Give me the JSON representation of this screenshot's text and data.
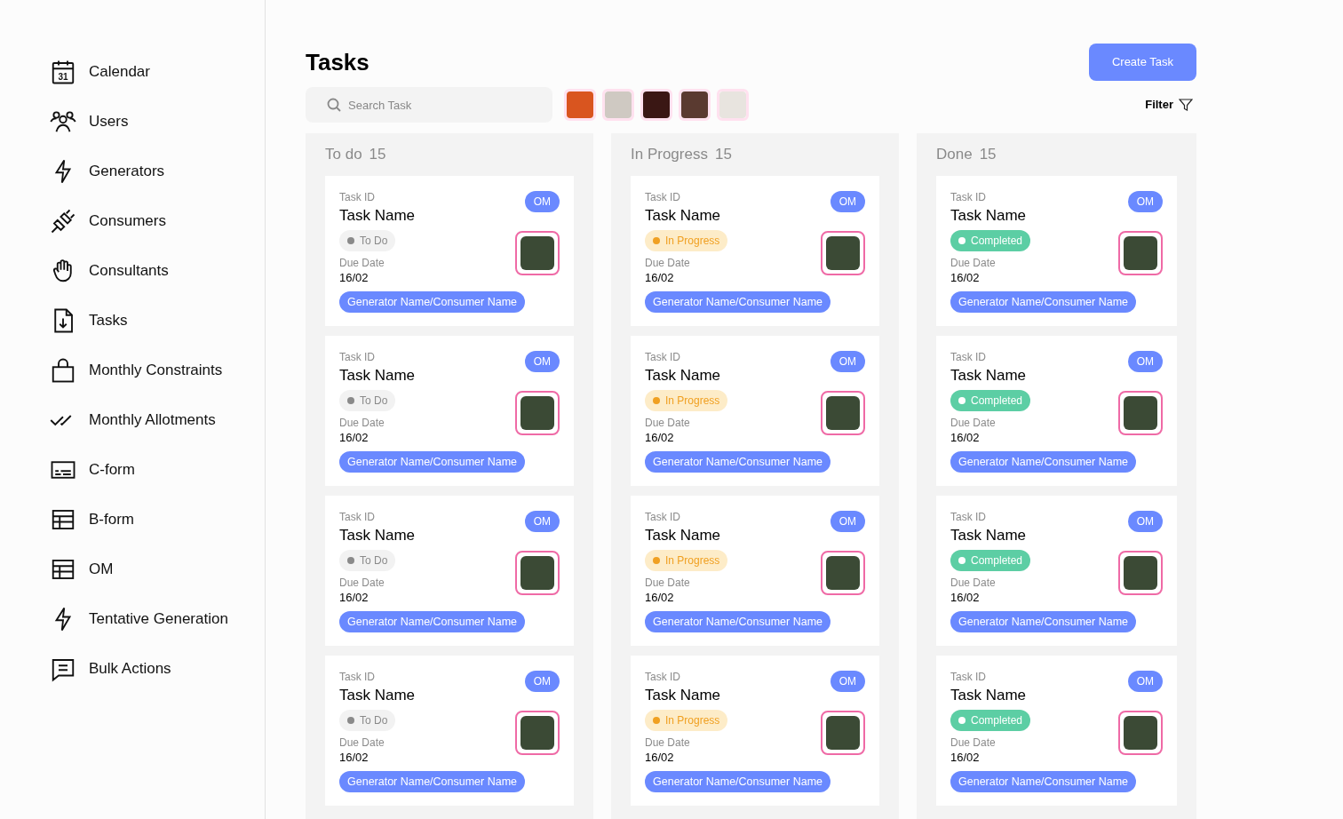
{
  "sidebar": {
    "items": [
      {
        "label": "Calendar",
        "icon_day": "31"
      },
      {
        "label": "Users"
      },
      {
        "label": "Generators"
      },
      {
        "label": "Consumers"
      },
      {
        "label": "Consultants"
      },
      {
        "label": "Tasks"
      },
      {
        "label": "Monthly Constraints"
      },
      {
        "label": "Monthly Allotments"
      },
      {
        "label": "C-form"
      },
      {
        "label": "B-form"
      },
      {
        "label": "OM"
      },
      {
        "label": "Tentative Generation"
      },
      {
        "label": "Bulk Actions"
      }
    ]
  },
  "header": {
    "title": "Tasks",
    "create_button": "Create Task",
    "search": {
      "placeholder": "Search Task"
    },
    "filter": "Filter"
  },
  "board": {
    "columns": [
      {
        "title": "To do",
        "count": "15",
        "cards": [
          {
            "id": "Task ID",
            "name": "Task Name",
            "badge": "OM",
            "status": {
              "kind": "todo",
              "label": "To Do"
            },
            "due_label": "Due Date",
            "due": "16/02",
            "tag": "Generator Name/Consumer Name"
          },
          {
            "id": "Task ID",
            "name": "Task Name",
            "badge": "OM",
            "status": {
              "kind": "todo",
              "label": "To Do"
            },
            "due_label": "Due Date",
            "due": "16/02",
            "tag": "Generator Name/Consumer Name"
          },
          {
            "id": "Task ID",
            "name": "Task Name",
            "badge": "OM",
            "status": {
              "kind": "todo",
              "label": "To Do"
            },
            "due_label": "Due Date",
            "due": "16/02",
            "tag": "Generator Name/Consumer Name"
          },
          {
            "id": "Task ID",
            "name": "Task Name",
            "badge": "OM",
            "status": {
              "kind": "todo",
              "label": "To Do"
            },
            "due_label": "Due Date",
            "due": "16/02",
            "tag": "Generator Name/Consumer Name"
          }
        ]
      },
      {
        "title": "In Progress",
        "count": "15",
        "cards": [
          {
            "id": "Task ID",
            "name": "Task Name",
            "badge": "OM",
            "status": {
              "kind": "progress",
              "label": "In Progress"
            },
            "due_label": "Due Date",
            "due": "16/02",
            "tag": "Generator Name/Consumer Name"
          },
          {
            "id": "Task ID",
            "name": "Task Name",
            "badge": "OM",
            "status": {
              "kind": "progress",
              "label": "In Progress"
            },
            "due_label": "Due Date",
            "due": "16/02",
            "tag": "Generator Name/Consumer Name"
          },
          {
            "id": "Task ID",
            "name": "Task Name",
            "badge": "OM",
            "status": {
              "kind": "progress",
              "label": "In Progress"
            },
            "due_label": "Due Date",
            "due": "16/02",
            "tag": "Generator Name/Consumer Name"
          },
          {
            "id": "Task ID",
            "name": "Task Name",
            "badge": "OM",
            "status": {
              "kind": "progress",
              "label": "In Progress"
            },
            "due_label": "Due Date",
            "due": "16/02",
            "tag": "Generator Name/Consumer Name"
          }
        ]
      },
      {
        "title": "Done",
        "count": "15",
        "cards": [
          {
            "id": "Task ID",
            "name": "Task Name",
            "badge": "OM",
            "status": {
              "kind": "completed",
              "label": "Completed"
            },
            "due_label": "Due Date",
            "due": "16/02",
            "tag": "Generator Name/Consumer Name"
          },
          {
            "id": "Task ID",
            "name": "Task Name",
            "badge": "OM",
            "status": {
              "kind": "completed",
              "label": "Completed"
            },
            "due_label": "Due Date",
            "due": "16/02",
            "tag": "Generator Name/Consumer Name"
          },
          {
            "id": "Task ID",
            "name": "Task Name",
            "badge": "OM",
            "status": {
              "kind": "completed",
              "label": "Completed"
            },
            "due_label": "Due Date",
            "due": "16/02",
            "tag": "Generator Name/Consumer Name"
          },
          {
            "id": "Task ID",
            "name": "Task Name",
            "badge": "OM",
            "status": {
              "kind": "completed",
              "label": "Completed"
            },
            "due_label": "Due Date",
            "due": "16/02",
            "tag": "Generator Name/Consumer Name"
          }
        ]
      }
    ]
  }
}
